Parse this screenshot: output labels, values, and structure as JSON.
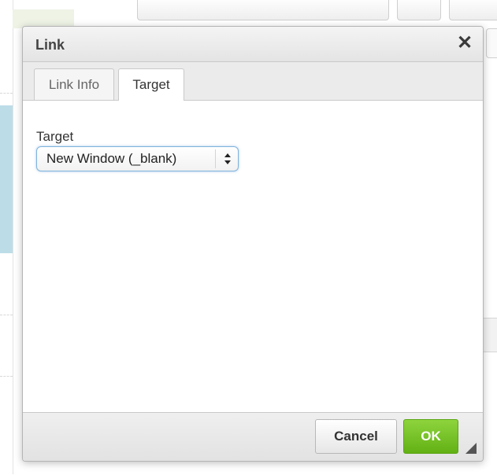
{
  "dialog": {
    "title": "Link",
    "close_icon": "close-icon",
    "tabs": [
      {
        "label": "Link Info",
        "active": false
      },
      {
        "label": "Target",
        "active": true
      }
    ],
    "target_field": {
      "label": "Target",
      "selected_value": "New Window (_blank)"
    },
    "buttons": {
      "cancel": "Cancel",
      "ok": "OK"
    }
  },
  "colors": {
    "ok_button": "#6cba1c",
    "focus_outline": "#7fb3dc",
    "title_text": "#444444"
  }
}
